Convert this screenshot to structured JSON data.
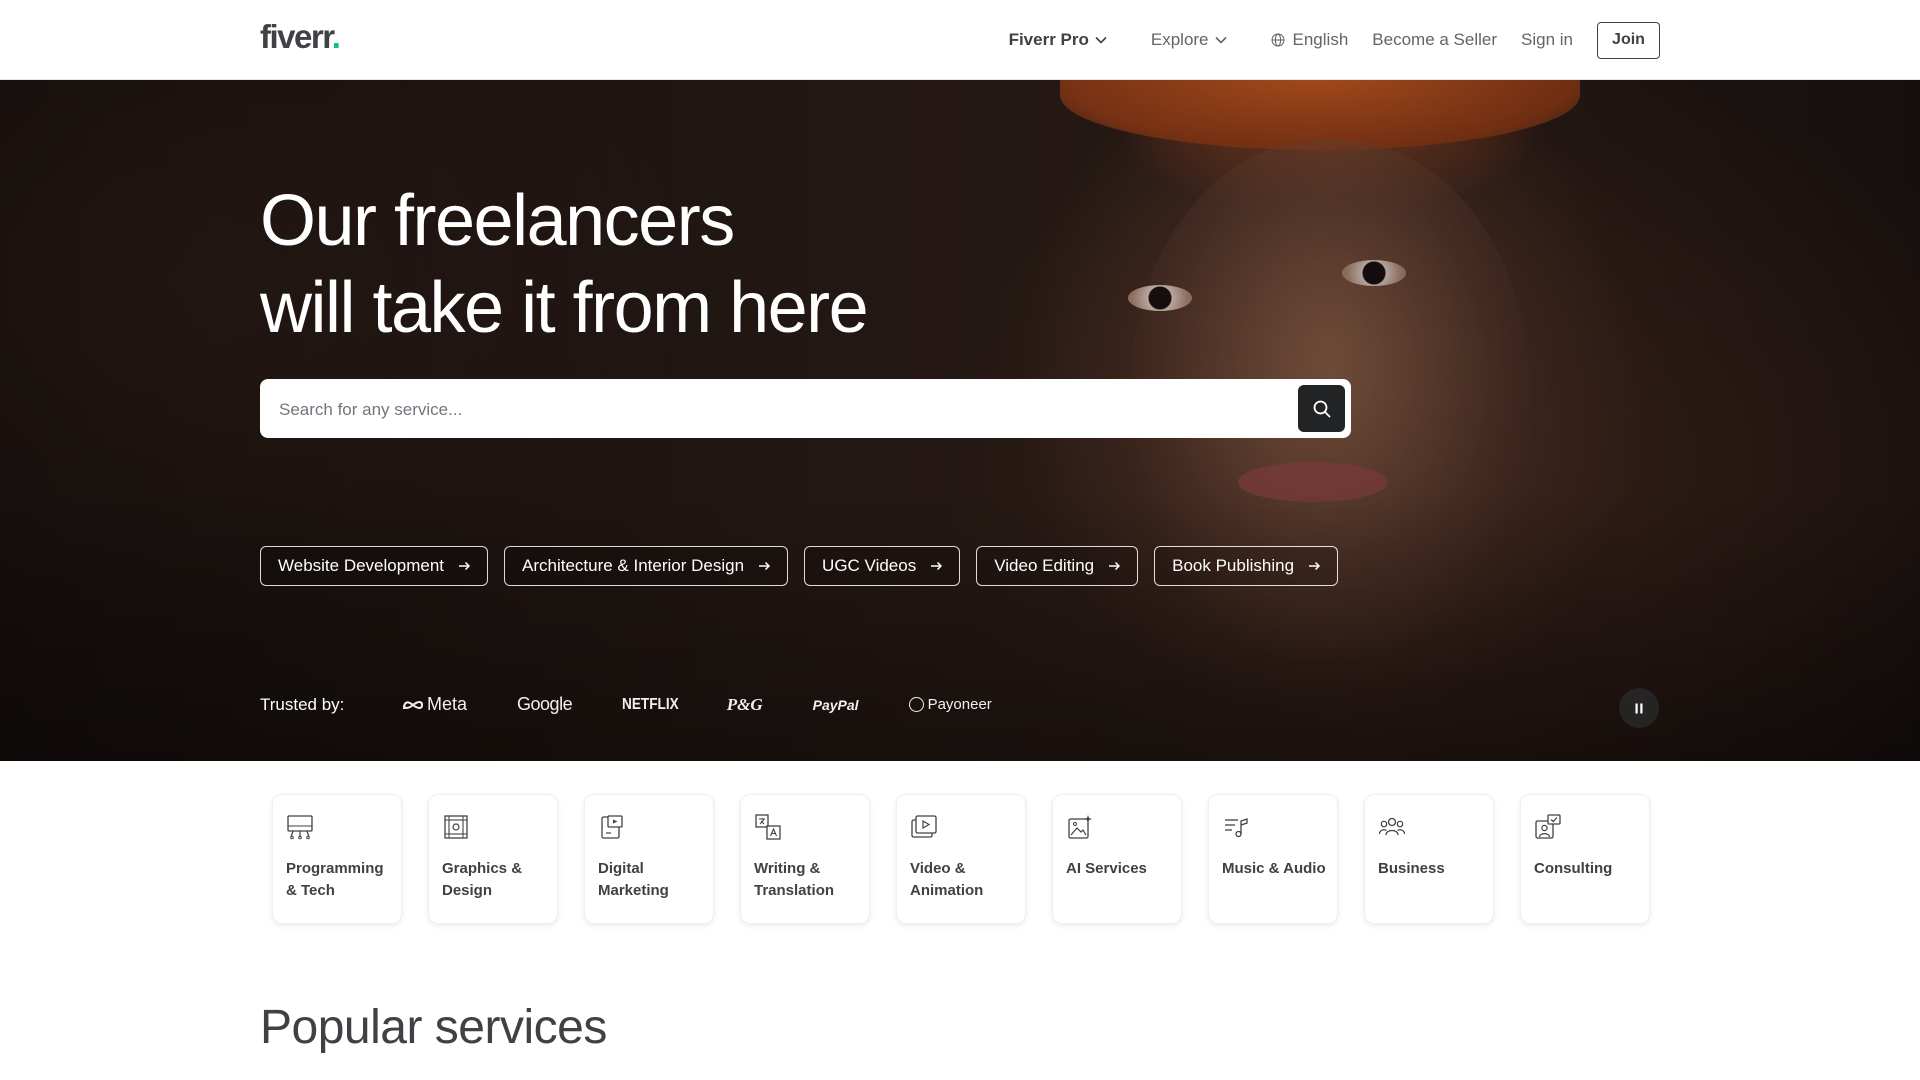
{
  "header": {
    "logo_text": "fiverr",
    "logo_dot": ".",
    "nav": {
      "fiverr_pro": "Fiverr Pro",
      "explore": "Explore",
      "language": "English",
      "become_seller": "Become a Seller",
      "sign_in": "Sign in",
      "join": "Join"
    }
  },
  "hero": {
    "title_line1": "Our freelancers",
    "title_line2": "will take it from here",
    "search": {
      "placeholder": "Search for any service..."
    },
    "pills": [
      {
        "label": "Website Development"
      },
      {
        "label": "Architecture & Interior Design"
      },
      {
        "label": "UGC Videos"
      },
      {
        "label": "Video Editing"
      },
      {
        "label": "Book Publishing"
      }
    ],
    "trusted": {
      "label": "Trusted by:",
      "brands": [
        "Meta",
        "Google",
        "NETFLIX",
        "P&G",
        "PayPal",
        "Payoneer"
      ]
    }
  },
  "categories": [
    {
      "label": "Programming & Tech",
      "icon": "monitor-code-icon"
    },
    {
      "label": "Graphics & Design",
      "icon": "design-frame-icon"
    },
    {
      "label": "Digital Marketing",
      "icon": "digital-marketing-icon"
    },
    {
      "label": "Writing & Translation",
      "icon": "translation-icon"
    },
    {
      "label": "Video & Animation",
      "icon": "video-play-icon"
    },
    {
      "label": "AI Services",
      "icon": "ai-image-icon"
    },
    {
      "label": "Music & Audio",
      "icon": "music-note-icon"
    },
    {
      "label": "Business",
      "icon": "people-icon"
    },
    {
      "label": "Consulting",
      "icon": "consulting-icon"
    }
  ],
  "sections": {
    "popular_title": "Popular services"
  },
  "colors": {
    "brand_green": "#1dbf73",
    "text_dark": "#404145",
    "button_dark": "#222325"
  }
}
